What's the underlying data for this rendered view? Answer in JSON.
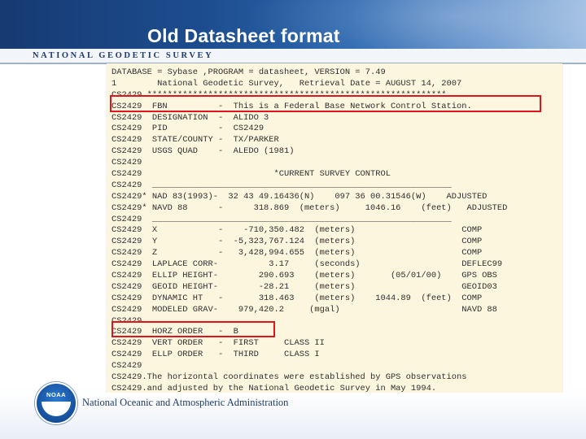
{
  "slide": {
    "title": "Old Datasheet format",
    "header_org": "NATIONAL GEODETIC SURVEY",
    "footer_agency": "National Oceanic and Atmospheric Administration",
    "logo_text": "NOAA"
  },
  "datasheet": {
    "lines": [
      "DATABASE = Sybase ,PROGRAM = datasheet, VERSION = 7.49",
      "1        National Geodetic Survey,   Retrieval Date = AUGUST 14, 2007",
      "CS2429 ***********************************************************",
      "CS2429  FBN          -  This is a Federal Base Network Control Station.",
      "CS2429  DESIGNATION  -  ALIDO 3",
      "CS2429  PID          -  CS2429",
      "CS2429  STATE/COUNTY -  TX/PARKER",
      "CS2429  USGS QUAD    -  ALEDO (1981)",
      "CS2429",
      "CS2429                          *CURRENT SURVEY CONTROL",
      "CS2429  ___________________________________________________________",
      "CS2429* NAD 83(1993)-  32 43 49.16436(N)    097 36 00.31546(W)    ADJUSTED",
      "CS2429* NAVD 88      -      318.869  (meters)     1046.16    (feet)   ADJUSTED",
      "CS2429  ___________________________________________________________",
      "CS2429  X            -    -710,350.482  (meters)                     COMP",
      "CS2429  Y            -  -5,323,767.124  (meters)                     COMP",
      "CS2429  Z            -   3,428,994.655  (meters)                     COMP",
      "CS2429  LAPLACE CORR-          3.17     (seconds)                    DEFLEC99",
      "CS2429  ELLIP HEIGHT-        290.693    (meters)       (05/01/00)    GPS OBS",
      "CS2429  GEOID HEIGHT-        -28.21     (meters)                     GEOID03",
      "CS2429  DYNAMIC HT   -       318.463    (meters)    1044.89  (feet)  COMP",
      "CS2429  MODELED GRAV-    979,420.2     (mgal)                        NAVD 88",
      "CS2429",
      "CS2429  HORZ ORDER   -  B",
      "CS2429  VERT ORDER   -  FIRST     CLASS II",
      "CS2429  ELLP ORDER   -  THIRD     CLASS I",
      "CS2429",
      "CS2429.The horizontal coordinates were established by GPS observations",
      "CS2429.and adjusted by the National Geodetic Survey in May 1994."
    ]
  }
}
